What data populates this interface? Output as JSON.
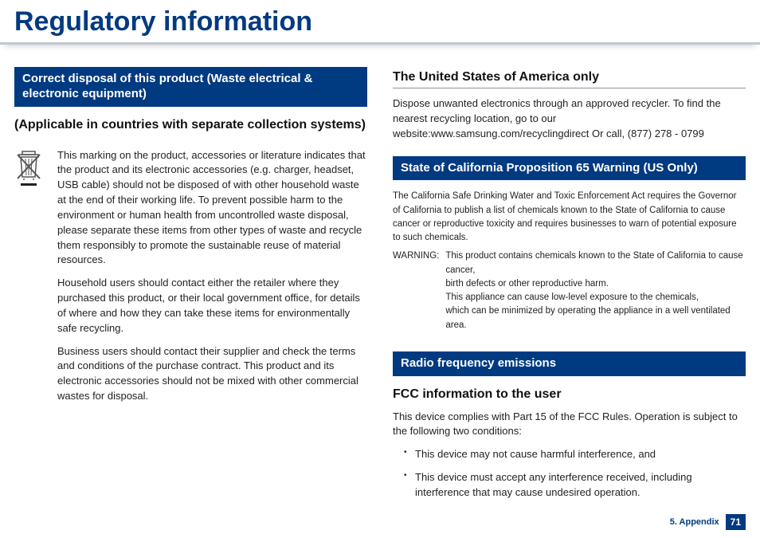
{
  "title": "Regulatory information",
  "left": {
    "section1": "Correct disposal of this product (Waste electrical & electronic equipment)",
    "subheading": "(Applicable in countries with separate collection systems)",
    "p1": "This marking on the product, accessories or literature indicates that the product and its electronic accessories (e.g. charger, headset, USB cable) should not be disposed of with other household waste at the end of their working life. To prevent possible harm to the environment or human health from uncontrolled waste disposal, please separate these items from other types of waste and recycle them responsibly to promote the sustainable reuse of material resources.",
    "p2": "Household users should contact either the retailer where they purchased this product, or their local government office, for details of where and how they can take these items for environmentally safe recycling.",
    "p3": "Business users should contact their supplier and check the terms and conditions of the purchase contract. This product and its electronic accessories should not be mixed with other commercial wastes for disposal."
  },
  "right": {
    "usa_heading": "The United States of America only",
    "usa_text": "Dispose unwanted electronics through an approved recycler. To find the nearest recycling location, go to our website:www.samsung.com/recyclingdirect Or call, (877) 278 - 0799",
    "cal_heading": "State of California Proposition 65 Warning (US Only)",
    "cal_p1": "The California Safe Drinking Water and Toxic Enforcement Act requires the Governor of California to publish a list of chemicals known to the State of California to cause cancer or reproductive toxicity and requires businesses to warn of potential exposure to such chemicals.",
    "warn_label": "WARNING:",
    "warn_l1": "This product contains chemicals known to the State of California to cause cancer,",
    "warn_l2": "birth defects or other reproductive harm.",
    "warn_l3": "This appliance can cause low-level exposure to the chemicals,",
    "warn_l4": "which can be minimized by operating the appliance in a well ventilated area.",
    "rf_heading": "Radio frequency emissions",
    "fcc_heading": "FCC information to the user",
    "fcc_intro": "This device complies with Part 15 of the FCC Rules. Operation is subject to the following two conditions:",
    "fcc_b1": "This device may not cause harmful interference, and",
    "fcc_b2": "This device must accept any interference received, including interference that may cause undesired operation."
  },
  "footer": {
    "chapter": "5. Appendix",
    "page": "71"
  }
}
